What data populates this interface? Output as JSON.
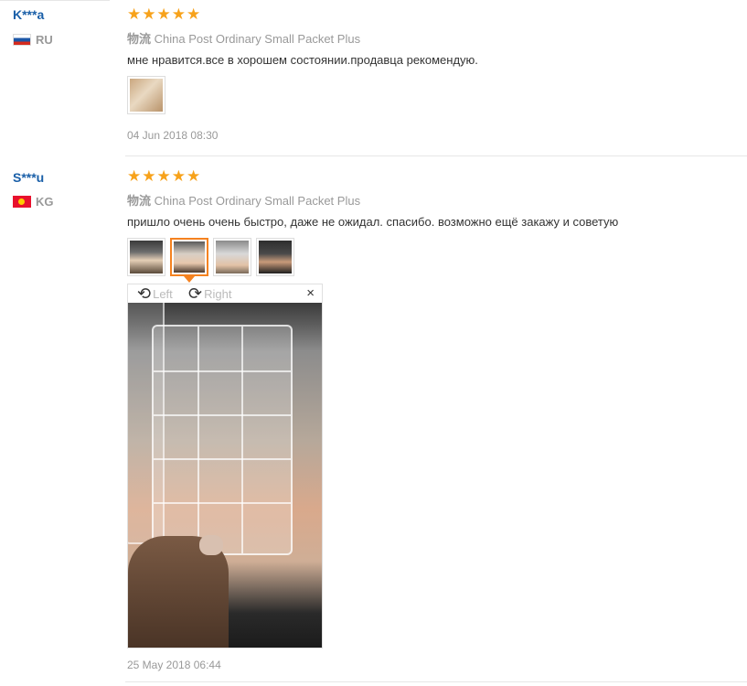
{
  "reviews": [
    {
      "user": "K***a",
      "country": "RU",
      "stars": "★★★★★",
      "shipping_label": "物流",
      "shipping_method": "China Post Ordinary Small Packet Plus",
      "comment": "мне нравится.все в хорошем состоянии.продавца рекомендую.",
      "date": "04 Jun 2018 08:30"
    },
    {
      "user": "S***u",
      "country": "KG",
      "stars": "★★★★★",
      "shipping_label": "物流",
      "shipping_method": "China Post Ordinary Small Packet Plus",
      "comment": "пришло очень очень быстро, даже не ожидал. спасибо. возможно ещё закажу и советую",
      "date": "25 May 2018 06:44",
      "viewer": {
        "rotate_left": "Left",
        "rotate_right": "Right",
        "close": "×"
      }
    }
  ],
  "colors": {
    "username": "#1a5fa8",
    "stars": "#f7a21b",
    "active_thumb": "#f58220"
  }
}
